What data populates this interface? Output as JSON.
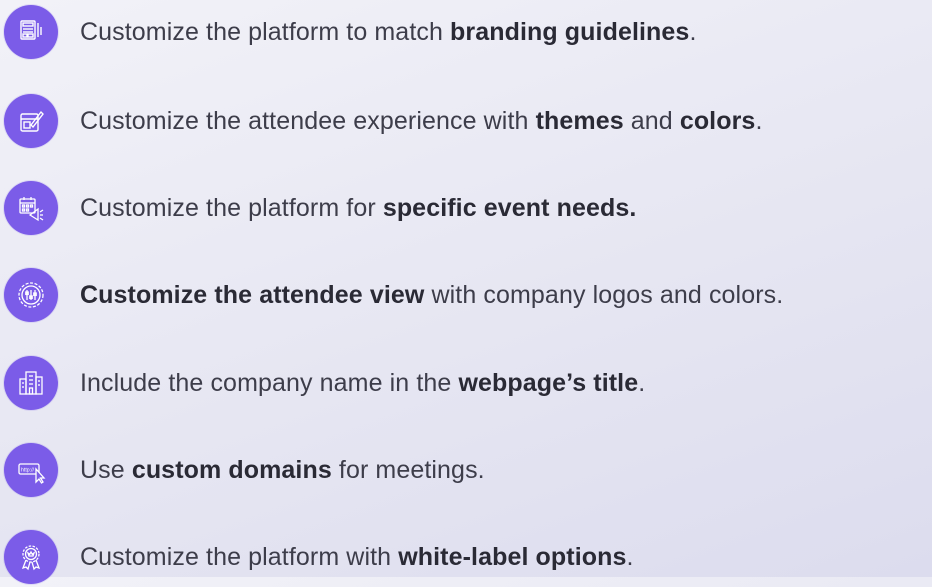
{
  "items": [
    {
      "icon": "branding-document-icon",
      "parts": [
        {
          "t": "Customize the platform to match ",
          "b": false
        },
        {
          "t": "branding guidelines",
          "b": true
        },
        {
          "t": ".",
          "b": false
        }
      ]
    },
    {
      "icon": "edit-theme-icon",
      "parts": [
        {
          "t": "Customize the attendee experience with ",
          "b": false
        },
        {
          "t": "themes",
          "b": true
        },
        {
          "t": " and ",
          "b": false
        },
        {
          "t": "colors",
          "b": true
        },
        {
          "t": ".",
          "b": false
        }
      ]
    },
    {
      "icon": "event-calendar-megaphone-icon",
      "parts": [
        {
          "t": "Customize the platform for ",
          "b": false
        },
        {
          "t": "specific event needs.",
          "b": true
        }
      ]
    },
    {
      "icon": "settings-sliders-gear-icon",
      "parts": [
        {
          "t": "Customize the attendee view",
          "b": true
        },
        {
          "t": " with company logos and colors.",
          "b": false
        }
      ]
    },
    {
      "icon": "company-building-icon",
      "parts": [
        {
          "t": "Include the company name in the ",
          "b": false
        },
        {
          "t": "webpage’s title",
          "b": true
        },
        {
          "t": ".",
          "b": false
        }
      ]
    },
    {
      "icon": "http-cursor-icon",
      "parts": [
        {
          "t": "Use ",
          "b": false
        },
        {
          "t": "custom domains",
          "b": true
        },
        {
          "t": " for meetings.",
          "b": false
        }
      ]
    },
    {
      "icon": "award-badge-icon",
      "parts": [
        {
          "t": "Customize the platform with ",
          "b": false
        },
        {
          "t": "white-label options",
          "b": true
        },
        {
          "t": ".",
          "b": false
        }
      ]
    }
  ],
  "http_label": "http://"
}
